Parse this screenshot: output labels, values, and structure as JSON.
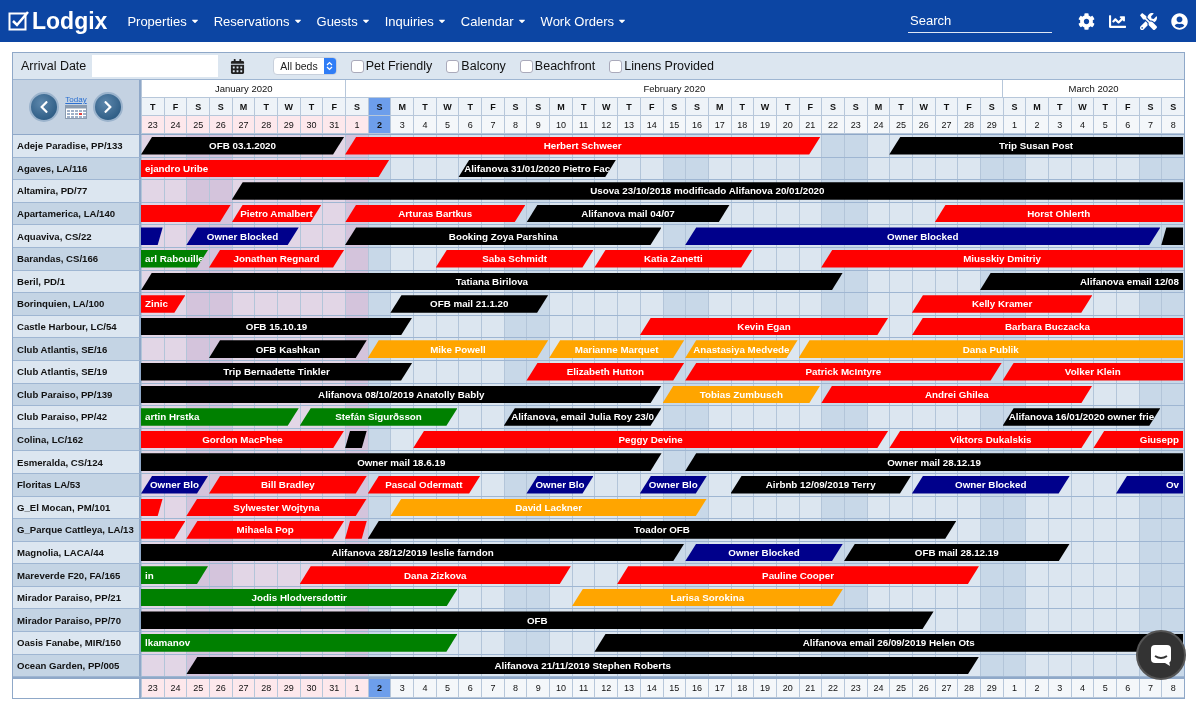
{
  "nav": {
    "logo": "Lodgix",
    "menu": [
      "Properties",
      "Reservations",
      "Guests",
      "Inquiries",
      "Calendar",
      "Work Orders"
    ],
    "search": {
      "placeholder": "Search"
    }
  },
  "filters": {
    "arrival_label": "Arrival Date",
    "beds": "All beds",
    "checkboxes": [
      {
        "label": "Pet Friendly",
        "checked": false
      },
      {
        "label": "Balcony",
        "checked": false
      },
      {
        "label": "Beachfront",
        "checked": false
      },
      {
        "label": "Linens Provided",
        "checked": false
      }
    ]
  },
  "calendar": {
    "today_link": "Today",
    "months": [
      {
        "label": "January 2020",
        "days": [
          {
            "weekday": "T",
            "day": "23",
            "past": true,
            "weekend": false,
            "selected": false
          },
          {
            "weekday": "F",
            "day": "24",
            "past": true,
            "weekend": false,
            "selected": false
          },
          {
            "weekday": "S",
            "day": "25",
            "past": true,
            "weekend": true,
            "selected": false
          },
          {
            "weekday": "S",
            "day": "26",
            "past": true,
            "weekend": true,
            "selected": false
          },
          {
            "weekday": "M",
            "day": "27",
            "past": true,
            "weekend": false,
            "selected": false
          },
          {
            "weekday": "T",
            "day": "28",
            "past": true,
            "weekend": false,
            "selected": false
          },
          {
            "weekday": "W",
            "day": "29",
            "past": true,
            "weekend": false,
            "selected": false
          },
          {
            "weekday": "T",
            "day": "30",
            "past": true,
            "weekend": false,
            "selected": false
          },
          {
            "weekday": "F",
            "day": "31",
            "past": true,
            "weekend": false,
            "selected": false
          }
        ]
      },
      {
        "label": "February 2020",
        "days": [
          {
            "weekday": "S",
            "day": "1",
            "past": true,
            "weekend": true,
            "selected": false
          },
          {
            "weekday": "S",
            "day": "2",
            "past": false,
            "weekend": true,
            "selected": true
          },
          {
            "weekday": "M",
            "day": "3",
            "past": false,
            "weekend": false,
            "selected": false
          },
          {
            "weekday": "T",
            "day": "4",
            "past": false,
            "weekend": false,
            "selected": false
          },
          {
            "weekday": "W",
            "day": "5",
            "past": false,
            "weekend": false,
            "selected": false
          },
          {
            "weekday": "T",
            "day": "6",
            "past": false,
            "weekend": false,
            "selected": false
          },
          {
            "weekday": "F",
            "day": "7",
            "past": false,
            "weekend": false,
            "selected": false
          },
          {
            "weekday": "S",
            "day": "8",
            "past": false,
            "weekend": true,
            "selected": false
          },
          {
            "weekday": "S",
            "day": "9",
            "past": false,
            "weekend": true,
            "selected": false
          },
          {
            "weekday": "M",
            "day": "10",
            "past": false,
            "weekend": false,
            "selected": false
          },
          {
            "weekday": "T",
            "day": "11",
            "past": false,
            "weekend": false,
            "selected": false
          },
          {
            "weekday": "W",
            "day": "12",
            "past": false,
            "weekend": false,
            "selected": false
          },
          {
            "weekday": "T",
            "day": "13",
            "past": false,
            "weekend": false,
            "selected": false
          },
          {
            "weekday": "F",
            "day": "14",
            "past": false,
            "weekend": false,
            "selected": false
          },
          {
            "weekday": "S",
            "day": "15",
            "past": false,
            "weekend": true,
            "selected": false
          },
          {
            "weekday": "S",
            "day": "16",
            "past": false,
            "weekend": true,
            "selected": false
          },
          {
            "weekday": "M",
            "day": "17",
            "past": false,
            "weekend": false,
            "selected": false
          },
          {
            "weekday": "T",
            "day": "18",
            "past": false,
            "weekend": false,
            "selected": false
          },
          {
            "weekday": "W",
            "day": "19",
            "past": false,
            "weekend": false,
            "selected": false
          },
          {
            "weekday": "T",
            "day": "20",
            "past": false,
            "weekend": false,
            "selected": false
          },
          {
            "weekday": "F",
            "day": "21",
            "past": false,
            "weekend": false,
            "selected": false
          },
          {
            "weekday": "S",
            "day": "22",
            "past": false,
            "weekend": true,
            "selected": false
          },
          {
            "weekday": "S",
            "day": "23",
            "past": false,
            "weekend": true,
            "selected": false
          },
          {
            "weekday": "M",
            "day": "24",
            "past": false,
            "weekend": false,
            "selected": false
          },
          {
            "weekday": "T",
            "day": "25",
            "past": false,
            "weekend": false,
            "selected": false
          },
          {
            "weekday": "W",
            "day": "26",
            "past": false,
            "weekend": false,
            "selected": false
          },
          {
            "weekday": "T",
            "day": "27",
            "past": false,
            "weekend": false,
            "selected": false
          },
          {
            "weekday": "F",
            "day": "28",
            "past": false,
            "weekend": false,
            "selected": false
          },
          {
            "weekday": "S",
            "day": "29",
            "past": false,
            "weekend": true,
            "selected": false
          }
        ]
      },
      {
        "label": "March 2020",
        "days": [
          {
            "weekday": "S",
            "day": "1",
            "past": false,
            "weekend": true,
            "selected": false
          },
          {
            "weekday": "M",
            "day": "2",
            "past": false,
            "weekend": false,
            "selected": false
          },
          {
            "weekday": "T",
            "day": "3",
            "past": false,
            "weekend": false,
            "selected": false
          },
          {
            "weekday": "W",
            "day": "4",
            "past": false,
            "weekend": false,
            "selected": false
          },
          {
            "weekday": "T",
            "day": "5",
            "past": false,
            "weekend": false,
            "selected": false
          },
          {
            "weekday": "F",
            "day": "6",
            "past": false,
            "weekend": false,
            "selected": false
          },
          {
            "weekday": "S",
            "day": "7",
            "past": false,
            "weekend": true,
            "selected": false
          },
          {
            "weekday": "S",
            "day": "8",
            "past": false,
            "weekend": true,
            "selected": false
          }
        ]
      }
    ],
    "properties": [
      {
        "name": "Adeje Paradise, PP/133",
        "bookings": [
          {
            "label": "OFB 03.1.2020",
            "color": "#000000"
          },
          {
            "label": "Herbert Schweer",
            "color": "#ff0000"
          },
          {
            "label": "Trip Susan Post",
            "color": "#000000"
          }
        ]
      },
      {
        "name": "Agaves, LA/116",
        "bookings": [
          {
            "label": "ejandro Uribe",
            "color": "#ff0000"
          },
          {
            "label": "Alifanova 31/01/2020 Pietro Fac",
            "color": "#000000"
          }
        ]
      },
      {
        "name": "Altamira, PD/77",
        "bookings": [
          {
            "label": "Usova 23/10/2018 modificado Alifanova 20/01/2020",
            "color": "#000000"
          }
        ]
      },
      {
        "name": "Apartamerica, LA/140",
        "bookings": [
          {
            "color": "#ff0000"
          },
          {
            "label": "Pietro Amalbert",
            "color": "#ff0000"
          },
          {
            "label": "Arturas Bartkus",
            "color": "#ff0000"
          },
          {
            "label": "Alifanova mail 04/07",
            "color": "#000000"
          },
          {
            "label": "Horst Ohlerth",
            "color": "#ff0000"
          }
        ]
      },
      {
        "name": "Aquaviva, CS/22",
        "bookings": [
          {
            "color": "#00008b"
          },
          {
            "label": "Owner Blocked",
            "color": "#00008b"
          },
          {
            "label": "Booking Zoya Parshina",
            "color": "#000000"
          },
          {
            "label": "Owner Blocked",
            "color": "#00008b"
          },
          {
            "color": "#000000"
          }
        ]
      },
      {
        "name": "Barandas, CS/166",
        "bookings": [
          {
            "label": "arl Rabouille",
            "color": "#008000"
          },
          {
            "label": "Jonathan Regnard",
            "color": "#ff0000"
          },
          {
            "label": "Saba Schmidt",
            "color": "#ff0000"
          },
          {
            "label": "Katia Zanetti",
            "color": "#ff0000"
          },
          {
            "label": "Miusskiy Dmitriy",
            "color": "#ff0000"
          }
        ]
      },
      {
        "name": "Beril, PD/1",
        "bookings": [
          {
            "label": "Tatiana Birilova",
            "color": "#000000"
          },
          {
            "label": "Alifanova email 12/08",
            "color": "#000000"
          }
        ]
      },
      {
        "name": "Borinquien, LA/100",
        "bookings": [
          {
            "label": "Zinic",
            "color": "#ff0000"
          },
          {
            "label": "OFB mail 21.1.20",
            "color": "#000000"
          },
          {
            "label": "Kelly Kramer",
            "color": "#ff0000"
          }
        ]
      },
      {
        "name": "Castle Harbour, LC/54",
        "bookings": [
          {
            "label": "OFB 15.10.19",
            "color": "#000000"
          },
          {
            "label": "Kevin Egan",
            "color": "#ff0000"
          },
          {
            "label": "Barbara Buczacka",
            "color": "#ff0000"
          }
        ]
      },
      {
        "name": "Club Atlantis, SE/16",
        "bookings": [
          {
            "label": "OFB Kashkan",
            "color": "#000000"
          },
          {
            "label": "Mike Powell",
            "color": "#ffa500"
          },
          {
            "label": "Marianne Marquet",
            "color": "#ffa500"
          },
          {
            "label": "Anastasiya Medvede",
            "color": "#ffa500"
          },
          {
            "label": "Dana Publik",
            "color": "#ffa500"
          }
        ]
      },
      {
        "name": "Club Atlantis, SE/19",
        "bookings": [
          {
            "label": "Trip Bernadette Tinkler",
            "color": "#000000"
          },
          {
            "label": "Elizabeth Hutton",
            "color": "#ff0000"
          },
          {
            "label": "Patrick McIntyre",
            "color": "#ff0000"
          },
          {
            "label": "Volker Klein",
            "color": "#ff0000"
          }
        ]
      },
      {
        "name": "Club Paraiso, PP/139",
        "bookings": [
          {
            "label": "Alifanova 08/10/2019 Anatolly Bably",
            "color": "#000000"
          },
          {
            "label": "Tobias Zumbusch",
            "color": "#ffa500"
          },
          {
            "label": "Andrei Ghilea",
            "color": "#ff0000"
          }
        ]
      },
      {
        "name": "Club Paraiso, PP/42",
        "bookings": [
          {
            "label": "artin Hrstka",
            "color": "#008000"
          },
          {
            "label": "Stefán Sigurðsson",
            "color": "#008000"
          },
          {
            "label": "Alifanova, email Julia Roy 23/0",
            "color": "#000000"
          },
          {
            "label": "Alifanova 16/01/2020 owner frie",
            "color": "#000000"
          }
        ]
      },
      {
        "name": "Colina, LC/162",
        "bookings": [
          {
            "label": "Gordon MacPhee",
            "color": "#ff0000"
          },
          {
            "color": "#000000"
          },
          {
            "label": "Peggy Devine",
            "color": "#ff0000"
          },
          {
            "label": "Viktors Dukalskis",
            "color": "#ff0000"
          },
          {
            "label": "Giusepp",
            "color": "#ff0000"
          }
        ]
      },
      {
        "name": "Esmeralda, CS/124",
        "bookings": [
          {
            "label": "Owner mail 18.6.19",
            "color": "#000000"
          },
          {
            "label": "Owner mail 28.12.19",
            "color": "#000000"
          }
        ]
      },
      {
        "name": "Floritas LA/53",
        "bookings": [
          {
            "label": "Owner Blo",
            "color": "#00008b"
          },
          {
            "label": "Bill Bradley",
            "color": "#ff0000"
          },
          {
            "label": "Pascal Odermatt",
            "color": "#ff0000"
          },
          {
            "label": "Owner Blo",
            "color": "#00008b"
          },
          {
            "label": "Owner Blo",
            "color": "#00008b"
          },
          {
            "label": "Airbnb 12/09/2019 Terry",
            "color": "#000000"
          },
          {
            "label": "Owner Blocked",
            "color": "#00008b"
          },
          {
            "label": "Ov",
            "color": "#00008b"
          }
        ]
      },
      {
        "name": "G_El Mocan, PM/101",
        "bookings": [
          {
            "color": "#ff0000"
          },
          {
            "label": "Sylwester Wojtyna",
            "color": "#ff0000"
          },
          {
            "label": "David Lackner",
            "color": "#ffa500"
          }
        ]
      },
      {
        "name": "G_Parque Cattleya, LA/13",
        "bookings": [
          {
            "color": "#ff0000"
          },
          {
            "label": "Mihaela Pop",
            "color": "#ff0000"
          },
          {
            "color": "#ff0000"
          },
          {
            "label": "Toador OFB",
            "color": "#000000"
          }
        ]
      },
      {
        "name": "Magnolia, LACA/44",
        "bookings": [
          {
            "label": "Alifanova 28/12/2019 leslie farndon",
            "color": "#000000"
          },
          {
            "label": "Owner Blocked",
            "color": "#00008b"
          },
          {
            "label": "OFB mail 28.12.19",
            "color": "#000000"
          }
        ]
      },
      {
        "name": "Mareverde F20, FA/165",
        "bookings": [
          {
            "label": "in",
            "color": "#008000"
          },
          {
            "label": "Dana Zizkova",
            "color": "#ff0000"
          },
          {
            "label": "Pauline Cooper",
            "color": "#ff0000"
          }
        ]
      },
      {
        "name": "Mirador Paraiso, PP/21",
        "bookings": [
          {
            "label": "Jodis Hlodversdottir",
            "color": "#008000"
          },
          {
            "label": "Larisa Sorokina",
            "color": "#ffa500"
          }
        ]
      },
      {
        "name": "Mirador Paraiso, PP/70",
        "bookings": [
          {
            "label": "OFB",
            "color": "#000000"
          }
        ]
      },
      {
        "name": "Oasis Fanabe, MIR/150",
        "bookings": [
          {
            "label": "lkamanov",
            "color": "#008000"
          },
          {
            "label": "Alifanova email 26/09/2019 Helen Ots",
            "color": "#000000"
          }
        ]
      },
      {
        "name": "Ocean Garden, PP/005",
        "bookings": [
          {
            "label": "Alifanova 21/11/2019 Stephen Roberts",
            "color": "#000000"
          }
        ]
      }
    ],
    "footer_days": [
      "23",
      "24",
      "25",
      "26",
      "27",
      "28",
      "29",
      "30",
      "31",
      "1",
      "2",
      "3",
      "4",
      "5",
      "6",
      "7",
      "8",
      "9",
      "10",
      "11",
      "12",
      "13",
      "14",
      "15",
      "16",
      "17",
      "18",
      "19",
      "20",
      "21",
      "22",
      "23",
      "24",
      "25",
      "26",
      "27",
      "28",
      "29",
      "1",
      "2",
      "3",
      "4",
      "5",
      "6",
      "7",
      "8"
    ]
  }
}
